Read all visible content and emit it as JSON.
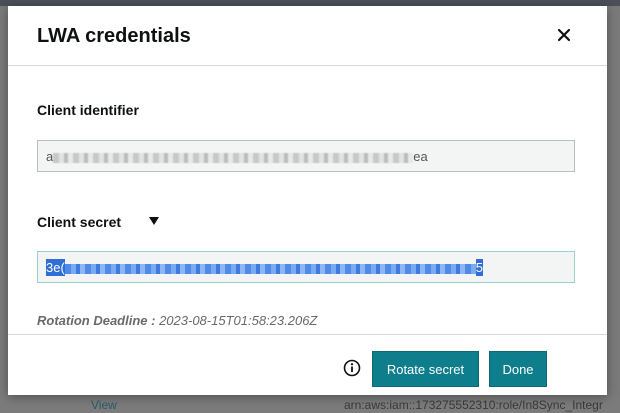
{
  "background": {
    "link_text": "View",
    "arn_text": "arn:aws:iam::173275552310:role/In8Sync_Integr"
  },
  "modal": {
    "title": "LWA credentials",
    "close_icon": "close-icon",
    "client_identifier": {
      "label": "Client identifier",
      "value_prefix": "a",
      "value_suffix": "ea"
    },
    "client_secret": {
      "label": "Client secret",
      "toggle_icon": "caret-down-icon",
      "value_prefix": "3e(",
      "value_suffix": "5"
    },
    "rotation_deadline": {
      "label": "Rotation Deadline :",
      "value": "2023-08-15T01:58:23.206Z"
    },
    "footer": {
      "info_icon": "info-icon",
      "rotate_label": "Rotate secret",
      "done_label": "Done"
    }
  },
  "colors": {
    "primary_button": "#0e7d8c",
    "selection": "#2f6ed6"
  }
}
